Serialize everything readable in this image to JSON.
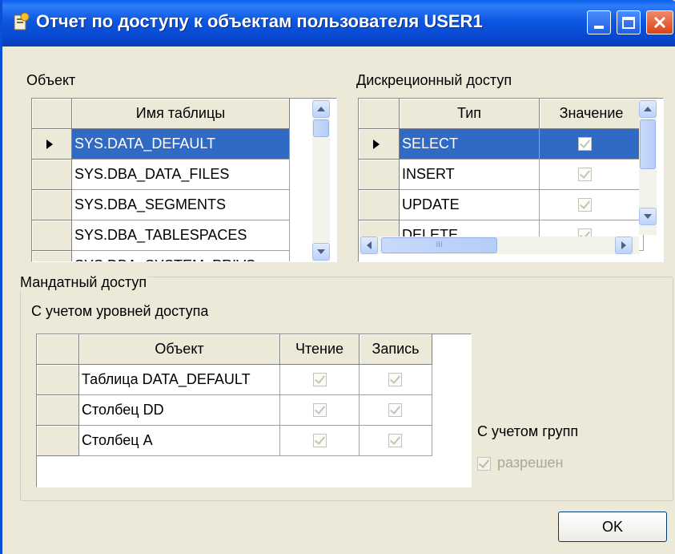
{
  "window": {
    "title": "Отчет по доступу к объектам пользователя USER1",
    "title_color": "#0a5eea"
  },
  "object_group": {
    "label": "Объект",
    "column": "Имя таблицы",
    "rows": [
      "SYS.DATA_DEFAULT",
      "SYS.DBA_DATA_FILES",
      "SYS.DBA_SEGMENTS",
      "SYS.DBA_TABLESPACES",
      "SYS.DBA_SYSTEM_PRIVS"
    ],
    "selected_index": 0
  },
  "discretionary_group": {
    "label": "Дискреционный доступ",
    "columns": [
      "Тип",
      "Значение"
    ],
    "rows": [
      {
        "type": "SELECT",
        "value": true
      },
      {
        "type": "INSERT",
        "value": true
      },
      {
        "type": "UPDATE",
        "value": true
      },
      {
        "type": "DELETE",
        "value": true
      }
    ],
    "selected_index": 0,
    "hscroll_grip": "III"
  },
  "mandatory_group": {
    "label": "Мандатный доступ",
    "levels_label": "С учетом уровней доступа",
    "columns": [
      "Объект",
      "Чтение",
      "Запись"
    ],
    "rows": [
      {
        "object": "Таблица DATA_DEFAULT",
        "read": true,
        "write": true
      },
      {
        "object": "Столбец DD",
        "read": true,
        "write": true
      },
      {
        "object": "Столбец A",
        "read": true,
        "write": true
      }
    ],
    "groups_label": "С учетом групп",
    "allowed_label": "разрешен",
    "allowed_checked": true
  },
  "buttons": {
    "ok": "OK"
  },
  "colors": {
    "selection": "#316ac5",
    "dialog_bg": "#ece9d8"
  }
}
